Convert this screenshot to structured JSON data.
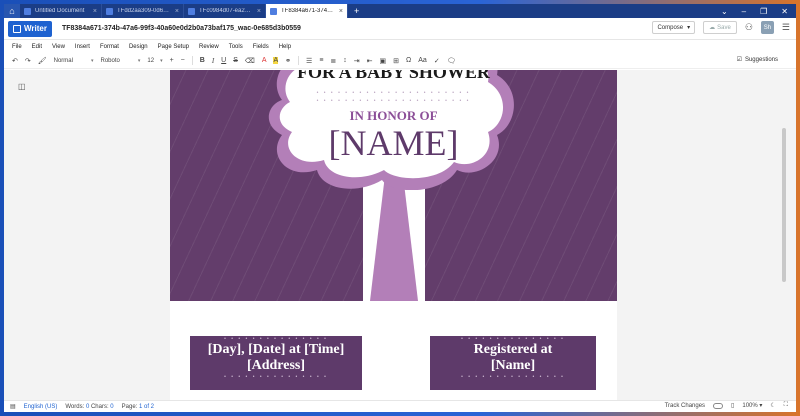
{
  "tabs": [
    {
      "label": "Untitled Document",
      "active": false
    },
    {
      "label": "TFdd2aa309-0d6a-4...",
      "active": false
    },
    {
      "label": "TFc0984d07-ea26-4b...",
      "active": false
    },
    {
      "label": "TF8384a671-374b-47...",
      "active": true
    }
  ],
  "app": {
    "name": "Writer"
  },
  "document": {
    "title": "TF8384a671-374b-47a6-99f3-40a60e0d2b0a73baf175_wac-0e685d3b0559"
  },
  "header": {
    "compose_label": "Compose",
    "save_label": "Save",
    "avatar_initials": "Sh"
  },
  "menu": [
    "File",
    "Edit",
    "View",
    "Insert",
    "Format",
    "Design",
    "Page Setup",
    "Review",
    "Tools",
    "Fields",
    "Help"
  ],
  "toolbar": {
    "style": "Normal",
    "font": "Roboto",
    "size": "12",
    "suggestions_label": "Suggestions"
  },
  "flyer": {
    "heading": "FOR A BABY SHOWER",
    "in_honor": "IN HONOR OF",
    "name": "[NAME]",
    "box1_line1": "[Day], [Date] at [Time]",
    "box1_line2": "[Address]",
    "box2_line1": "Registered at",
    "box2_line2": "[Name]"
  },
  "status": {
    "language": "English (US)",
    "words_label": "Words:",
    "words": "0",
    "chars_label": "Chars:",
    "chars": "0",
    "page_label": "Page:",
    "page_current": "1",
    "page_of": "of 2",
    "track_changes": "Track Changes",
    "zoom": "100%"
  },
  "colors": {
    "brand": "#1e62d0",
    "flyer_purple": "#5e3a6a",
    "tie": "#b37fb8",
    "accent_text": "#8c4f98"
  }
}
